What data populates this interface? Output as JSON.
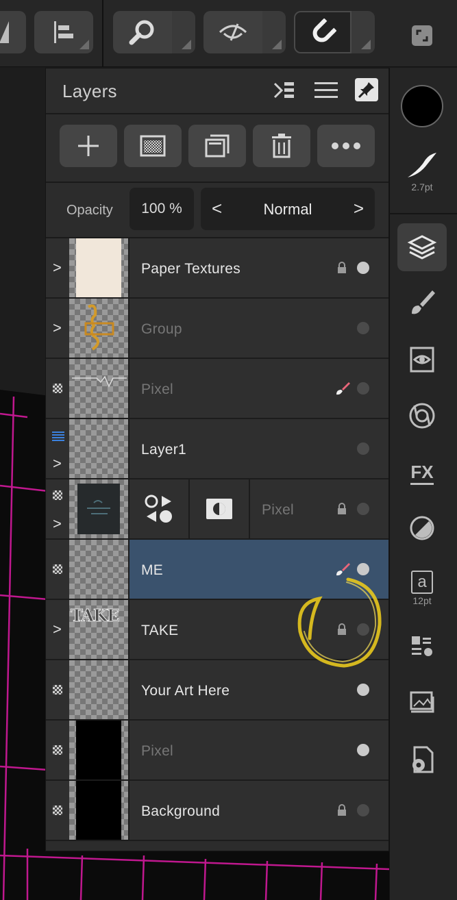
{
  "panel": {
    "title": "Layers",
    "opacity_label": "Opacity",
    "opacity_value": "100 %",
    "blend_mode": "Normal",
    "blend_prev": "<",
    "blend_next": ">"
  },
  "layers": [
    {
      "name": "Paper Textures",
      "dim": false,
      "locked": true,
      "visible": true
    },
    {
      "name": "Group",
      "dim": true,
      "locked": false,
      "visible": false
    },
    {
      "name": "Pixel",
      "dim": true,
      "locked": false,
      "visible": false,
      "painting": true
    },
    {
      "name": "Layer1",
      "dim": false,
      "locked": false,
      "visible": false
    },
    {
      "name": "Pixel",
      "dim": true,
      "locked": true,
      "visible": false
    },
    {
      "name": "ME",
      "dim": false,
      "locked": false,
      "visible": true,
      "painting": true,
      "selected": true
    },
    {
      "name": "TAKE",
      "dim": false,
      "locked": true,
      "visible": false
    },
    {
      "name": "Your Art Here",
      "dim": false,
      "locked": false,
      "visible": true
    },
    {
      "name": "Pixel",
      "dim": true,
      "locked": false,
      "visible": true
    },
    {
      "name": "Background",
      "dim": false,
      "locked": true,
      "visible": false
    }
  ],
  "thumb_text": {
    "take": "TAKE"
  },
  "studio": {
    "brush_size": "2.7pt",
    "text_size": "12pt",
    "text_glyph": "a"
  },
  "colors": {
    "accent_selected": "#3a526d",
    "canvas_grid": "#c0188f",
    "annotation": "#e8c81e"
  }
}
